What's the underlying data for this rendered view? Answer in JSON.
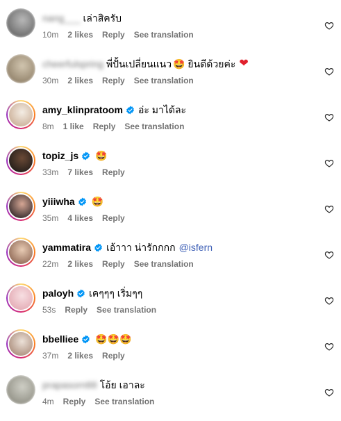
{
  "comments": [
    {
      "username": "nang___",
      "blurred": true,
      "verified": false,
      "text": "เล่าสิครับ",
      "emoji": "",
      "mention": "",
      "time": "10m",
      "likes": "2 likes",
      "reply": "Reply",
      "translate": "See translation",
      "avatar_colors": [
        "#606060",
        "#b9b9b9"
      ]
    },
    {
      "username": "cheerfulspring",
      "blurred": true,
      "verified": false,
      "text": "พี่ปั้นเปลี่ยนแนว",
      "emoji": "🤩 ยินดีด้วยค่ะ",
      "heart": "❤",
      "mention": "",
      "time": "30m",
      "likes": "2 likes",
      "reply": "Reply",
      "translate": "See translation",
      "avatar_colors": [
        "#8a7a62",
        "#d2c6b0"
      ]
    },
    {
      "username": "amy_klinpratoom",
      "blurred": false,
      "verified": true,
      "text": "อ่ะ มาได้ละ",
      "emoji": "",
      "mention": "",
      "time": "8m",
      "likes": "1 like",
      "reply": "Reply",
      "translate": "See translation",
      "avatar_colors": [
        "#c9ac94",
        "#f4ede4"
      ]
    },
    {
      "username": "topiz_js",
      "blurred": false,
      "verified": true,
      "text": "",
      "emoji": "🤩",
      "mention": "",
      "time": "33m",
      "likes": "7 likes",
      "reply": "Reply",
      "translate": "",
      "avatar_colors": [
        "#1e1a18",
        "#6b4a36"
      ]
    },
    {
      "username": "yiiiwha",
      "blurred": false,
      "verified": true,
      "text": "",
      "emoji": "🤩",
      "mention": "",
      "time": "35m",
      "likes": "4 likes",
      "reply": "Reply",
      "translate": "",
      "avatar_colors": [
        "#2c2326",
        "#d6a795"
      ]
    },
    {
      "username": "yammatira",
      "blurred": false,
      "verified": true,
      "text": "เอ้าาา น่ารักกกก",
      "emoji": "",
      "mention": "@isfern",
      "time": "22m",
      "likes": "2 likes",
      "reply": "Reply",
      "translate": "See translation",
      "avatar_colors": [
        "#8c6552",
        "#e8cbb4"
      ]
    },
    {
      "username": "paloyh",
      "blurred": false,
      "verified": true,
      "text": "เคๆๆๆ เริ่มๆๆ",
      "emoji": "",
      "mention": "",
      "time": "53s",
      "likes": "",
      "reply": "Reply",
      "translate": "See translation",
      "avatar_colors": [
        "#e3a8b2",
        "#f7dfe2"
      ]
    },
    {
      "username": "bbelliee",
      "blurred": false,
      "verified": true,
      "text": "",
      "emoji": "🤩🤩🤩",
      "mention": "",
      "time": "37m",
      "likes": "2 likes",
      "reply": "Reply",
      "translate": "",
      "avatar_colors": [
        "#a88a78",
        "#ece1d8"
      ]
    },
    {
      "username": "prapasorn88",
      "blurred": true,
      "verified": false,
      "text": "โอ้ย เอาละ",
      "emoji": "",
      "mention": "",
      "time": "4m",
      "likes": "",
      "reply": "Reply",
      "translate": "See translation",
      "avatar_colors": [
        "#8b8a7f",
        "#cfcfc6"
      ]
    }
  ],
  "theme": {
    "verified_blue": "#0095f6",
    "meta_gray": "#737373",
    "mention_blue": "#3d5fb6",
    "ring_gradient": "instagram"
  }
}
